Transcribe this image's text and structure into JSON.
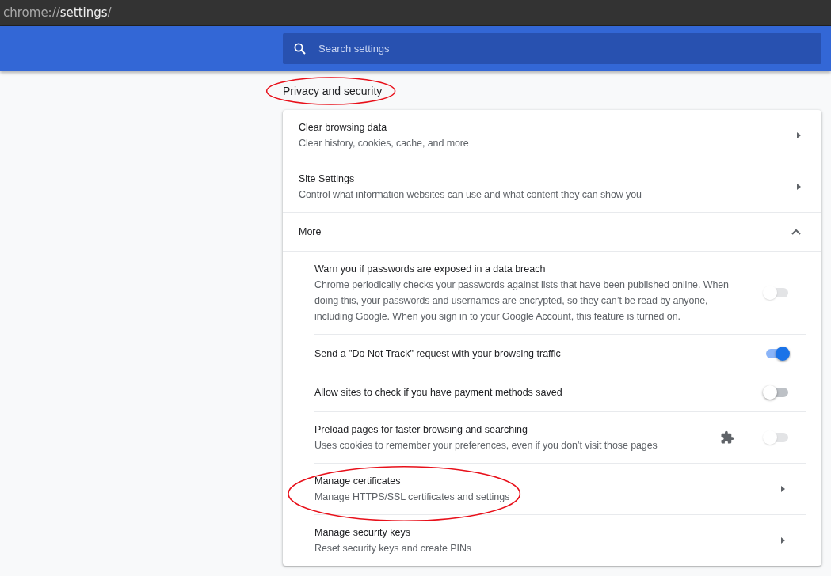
{
  "address_bar": {
    "scheme": "chrome://",
    "path": "settings",
    "tail": "/"
  },
  "search": {
    "placeholder": "Search settings"
  },
  "section": {
    "title": "Privacy and security",
    "circled": true
  },
  "rows": [
    {
      "kind": "link",
      "title": "Clear browsing data",
      "subtitle": "Clear history, cookies, cache, and more"
    },
    {
      "kind": "link",
      "title": "Site Settings",
      "subtitle": "Control what information websites can use and what content they can show you"
    },
    {
      "kind": "expand",
      "title": "More",
      "expanded": true
    }
  ],
  "more_rows": [
    {
      "kind": "toggle",
      "title": "Warn you if passwords are exposed in a data breach",
      "subtitle": "Chrome periodically checks your passwords against lists that have been published online. When doing this, your passwords and usernames are encrypted, so they can’t be read by anyone, including Google. When you sign in to your Google Account, this feature is turned on.",
      "on": false,
      "disabled": true,
      "extension_controlled": false
    },
    {
      "kind": "toggle",
      "title": "Send a \"Do Not Track\" request with your browsing traffic",
      "on": true,
      "disabled": false,
      "extension_controlled": false
    },
    {
      "kind": "toggle",
      "title": "Allow sites to check if you have payment methods saved",
      "on": false,
      "disabled": false,
      "extension_controlled": false
    },
    {
      "kind": "toggle",
      "title": "Preload pages for faster browsing and searching",
      "subtitle": "Uses cookies to remember your preferences, even if you don’t visit those pages",
      "on": false,
      "disabled": true,
      "extension_controlled": true
    },
    {
      "kind": "link",
      "title": "Manage certificates",
      "subtitle": "Manage HTTPS/SSL certificates and settings",
      "circled": true
    },
    {
      "kind": "link",
      "title": "Manage security keys",
      "subtitle": "Reset security keys and create PINs"
    }
  ]
}
